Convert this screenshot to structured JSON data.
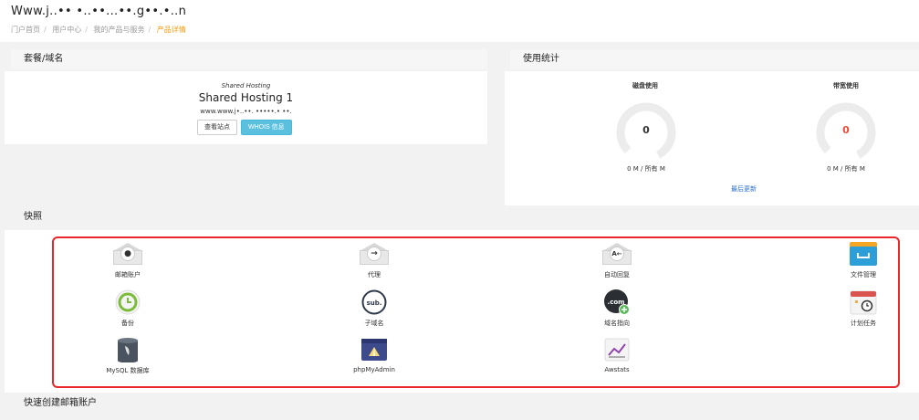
{
  "header": {
    "title": "Www.j..•• •..••...••.g••.•..n",
    "breadcrumb": [
      "门户首页",
      "用户中心",
      "我的产品与服务",
      "产品详情"
    ]
  },
  "plan_section": {
    "heading": "套餐/域名",
    "type": "Shared Hosting",
    "name": "Shared Hosting 1",
    "domain": "www.www.j•..••. •••••.• ••.",
    "buttons": {
      "visit": "查看站点",
      "whois": "WHOIS 信息"
    }
  },
  "usage_section": {
    "heading": "使用统计",
    "disk": {
      "label": "磁盘使用",
      "value": "0",
      "usage_text": "0 M / 所有 M"
    },
    "bandwidth": {
      "label": "带宽使用",
      "value": "0",
      "usage_text": "0 M / 所有 M"
    },
    "last_updated": "最后更新"
  },
  "shortcuts_section": {
    "heading": "快照",
    "items": [
      {
        "label": "邮箱账户",
        "icon": "email-account-icon"
      },
      {
        "label": "代理",
        "icon": "forwarder-icon"
      },
      {
        "label": "自动回复",
        "icon": "autoresponder-icon"
      },
      {
        "label": "文件管理",
        "icon": "file-manager-icon"
      },
      {
        "label": "备份",
        "icon": "backup-icon"
      },
      {
        "label": "子域名",
        "icon": "subdomain-icon"
      },
      {
        "label": "域名指向",
        "icon": "domain-pointer-icon"
      },
      {
        "label": "计划任务",
        "icon": "cron-jobs-icon"
      },
      {
        "label": "MySQL 数据库",
        "icon": "mysql-database-icon"
      },
      {
        "label": "phpMyAdmin",
        "icon": "phpmyadmin-icon"
      },
      {
        "label": "Awstats",
        "icon": "awstats-icon"
      }
    ]
  },
  "quick_create": {
    "heading": "快速创建邮箱账户"
  },
  "colors": {
    "accent": "#f39c12",
    "info": "#5bc0de",
    "highlight": "#e8262b",
    "danger": "#e74c3c",
    "link": "#2a6fc9"
  }
}
